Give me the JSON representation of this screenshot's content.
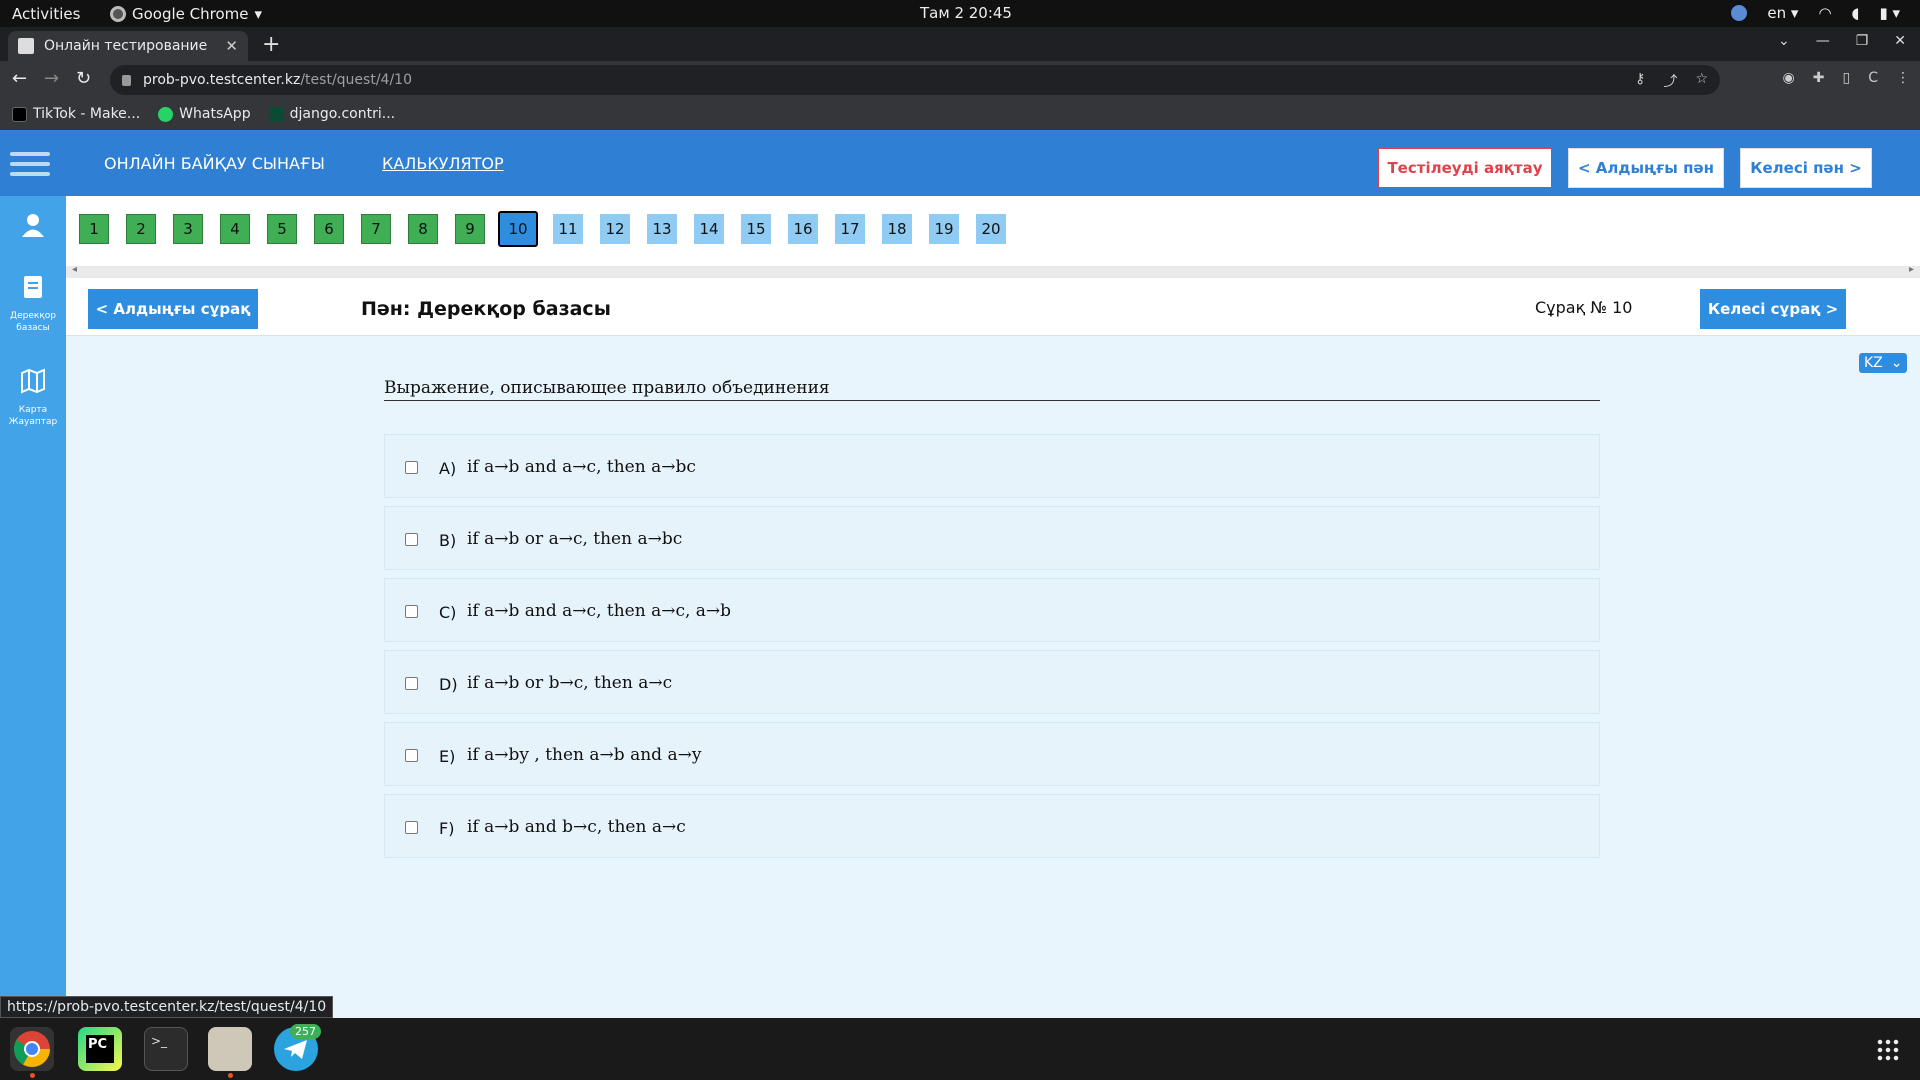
{
  "system": {
    "activities": "Activities",
    "app_name": "Google Chrome",
    "clock": "Там 2  20:45",
    "keyboard_layout": "en"
  },
  "browser": {
    "tab_title": "Онлайн тестирование",
    "url_host": "prob-pvo.testcenter.kz",
    "url_path": "/test/quest/4/10",
    "profile_initial": "C",
    "bookmarks": [
      "TikTok - Make...",
      "WhatsApp",
      "django.contri..."
    ],
    "status_url": "https://prob-pvo.testcenter.kz/test/quest/4/10"
  },
  "header": {
    "title": "ОНЛАЙН БАЙҚАУ СЫНАҒЫ",
    "calculator": "КАЛЬКУЛЯТОР",
    "finish_button": "Тестілеуді аяқтау",
    "prev_subject_button": "< Алдыңғы пән",
    "next_subject_button": "Келесі пән >"
  },
  "sidebar": {
    "items": [
      {
        "label": "",
        "icon": "user-icon"
      },
      {
        "label": "Дерекқор базасы",
        "icon": "book-icon"
      },
      {
        "label": "Карта Жауаптар",
        "icon": "map-icon"
      }
    ]
  },
  "question_nav": {
    "numbers": [
      "1",
      "2",
      "3",
      "4",
      "5",
      "6",
      "7",
      "8",
      "9",
      "10",
      "11",
      "12",
      "13",
      "14",
      "15",
      "16",
      "17",
      "18",
      "19",
      "20"
    ],
    "answered": 9,
    "current": 10
  },
  "question": {
    "prev_button": "< Алдыңғы сұрақ",
    "subject": "Пән: Дерекқор базасы",
    "number_label": "Сұрақ № 10",
    "next_button": "Келесі сұрақ >",
    "language": "KZ",
    "text": "Выражение, описывающее правило объединения",
    "answers": [
      {
        "letter": "A)",
        "text": "if a→b and a→c, then a→bc"
      },
      {
        "letter": "B)",
        "text": "if a→b or a→c, then a→bc"
      },
      {
        "letter": "C)",
        "text": "if a→b and a→c, then a→c, a→b"
      },
      {
        "letter": "D)",
        "text": "if a→b or b→c, then a→c"
      },
      {
        "letter": "E)",
        "text": "if a→by , then a→b and a→y"
      },
      {
        "letter": "F)",
        "text": "if a→b and b→c, then a→c"
      }
    ]
  },
  "dock": {
    "telegram_badge": "257"
  },
  "colors": {
    "header_blue": "#2f7fd5",
    "answered_green": "#3fae55",
    "unanswered_blue": "#8fcbf2",
    "finish_red": "#e0424b"
  }
}
